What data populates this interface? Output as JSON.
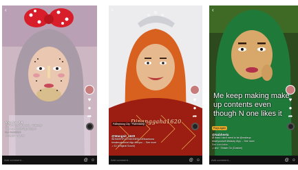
{
  "back_glyph": "‹",
  "icons": {
    "rail": [
      "heart-icon",
      "comment-icon",
      "share-icon"
    ],
    "bottom": [
      "at-icon",
      "emoji-icon"
    ]
  },
  "colors": {
    "video1_bg": "#cfb8c4",
    "video2_bg": "#e9e6e9",
    "video3_bg": "#2b4a1c"
  },
  "videos": [
    {
      "author": "Ang Ao · 2-6",
      "caption_lines": [
        "Lips and pout at fe and... #makeup",
        "#makeuptutorial #fyp #foryou"
      ],
      "sound": "♫ Playlist · 9 y ras",
      "translation": "See translation",
      "comment_placeholder": "Add comment...",
      "counts": [
        "",
        "",
        ""
      ],
      "overlay": "",
      "tag": ""
    },
    {
      "author": "@Wangsit_1620",
      "caption_lines": [
        "WONDERFUL INDONESIA #Blusetoma",
        "#makeuptutorial #fyp #foryou ... See more"
      ],
      "sound": "♫ DJ (Original Sound)",
      "translation": "",
      "comment_placeholder": "Add comment...",
      "counts": [
        "",
        "",
        ""
      ],
      "overlay": "Dinanggaha1620",
      "tag": "Palembang City · Palembang"
    },
    {
      "author": "@Nabheela",
      "caption_lines": [
        "At least I don't need to be @makeup",
        "#loveyourself #beauty #fyp ... See more"
      ],
      "sound": "♫ and · Shawn Go (Custom)",
      "translation": "See translation",
      "comment_placeholder": "Add comment...",
      "counts": [
        "",
        "",
        ""
      ],
      "overlay": "Me keep making make up contents even though N one likes it",
      "tag": "Plays again"
    }
  ]
}
